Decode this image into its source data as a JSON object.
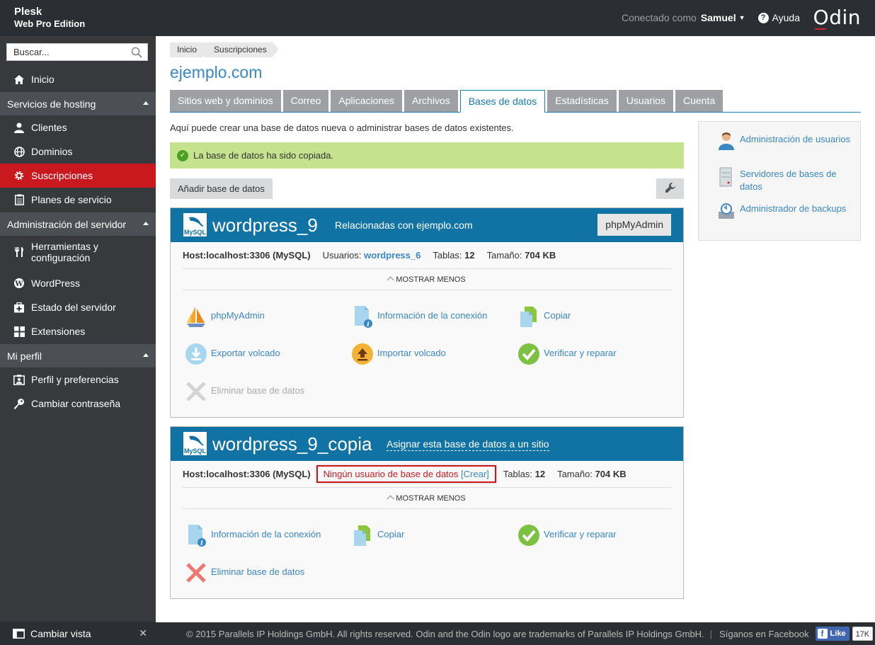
{
  "brand": {
    "name": "Plesk",
    "edition": "Web Pro Edition",
    "logo": "Odin"
  },
  "topbar": {
    "connected_label": "Conectado como",
    "user": "Samuel",
    "help": "Ayuda"
  },
  "sidebar": {
    "search_placeholder": "Buscar...",
    "home": "Inicio",
    "sections": [
      {
        "title": "Servicios de hosting",
        "items": [
          "Clientes",
          "Dominios",
          "Suscripciones",
          "Planes de servicio"
        ]
      },
      {
        "title": "Administración del servidor",
        "items": [
          "Herramientas y configuración",
          "WordPress",
          "Estado del servidor",
          "Extensiones"
        ]
      },
      {
        "title": "Mi perfil",
        "items": [
          "Perfil y preferencias",
          "Cambiar contraseña"
        ]
      }
    ],
    "active_item": "Suscripciones",
    "change_view": "Cambiar vista"
  },
  "breadcrumb": [
    "Inicio",
    "Suscripciones"
  ],
  "page_title": "ejemplo.com",
  "tabs": [
    "Sitios web y dominios",
    "Correo",
    "Aplicaciones",
    "Archivos",
    "Bases de datos",
    "Estadísticas",
    "Usuarios",
    "Cuenta"
  ],
  "active_tab": "Bases de datos",
  "intro": "Aquí puede crear una base de datos nueva o administrar bases de datos existentes.",
  "message": "La base de datos ha sido copiada.",
  "add_button": "Añadir base de datos",
  "databases": [
    {
      "name": "wordpress_9",
      "related": "Relacionadas con ejemplo.com",
      "pma_button": "phpMyAdmin",
      "host_label": "Host:",
      "host": "localhost:3306 (MySQL)",
      "users_label": "Usuarios:",
      "user": "wordpress_6",
      "tables_label": "Tablas:",
      "tables": "12",
      "size_label": "Tamaño:",
      "size": "704 KB",
      "show_less": "MOSTRAR MENOS",
      "actions": [
        "phpMyAdmin",
        "Información de la conexión",
        "Copiar",
        "Exportar volcado",
        "Importar volcado",
        "Verificar y reparar",
        "Eliminar base de datos"
      ]
    },
    {
      "name": "wordpress_9_copia",
      "assign": "Asignar esta base de datos a un sitio",
      "host_label": "Host:",
      "host": "localhost:3306 (MySQL)",
      "no_user": "Ningún usuario de base de datos",
      "create": "[Crear]",
      "tables_label": "Tablas:",
      "tables": "12",
      "size_label": "Tamaño:",
      "size": "704 KB",
      "show_less": "MOSTRAR MENOS",
      "actions": [
        "Información de la conexión",
        "Copiar",
        "Verificar y reparar",
        "Eliminar base de datos"
      ]
    }
  ],
  "right_links": [
    {
      "label": "Administración de usuarios",
      "icon": "users-icon"
    },
    {
      "label": "Servidores de bases de datos",
      "icon": "db-server-icon"
    },
    {
      "label": "Administrador de backups",
      "icon": "backup-icon"
    }
  ],
  "footer": {
    "copyright": "© 2015 Parallels IP Holdings GmbH. All rights reserved. Odin and the Odin logo are trademarks of Parallels IP Holdings GmbH.",
    "follow": "Síganos en Facebook",
    "like": "Like",
    "count": "17K"
  },
  "colors": {
    "header": "#2b2f33",
    "sidebar": "#37393c",
    "active": "#c9191e",
    "db_header": "#1173a3",
    "link": "#3a87c4",
    "success": "#c5e38f"
  }
}
